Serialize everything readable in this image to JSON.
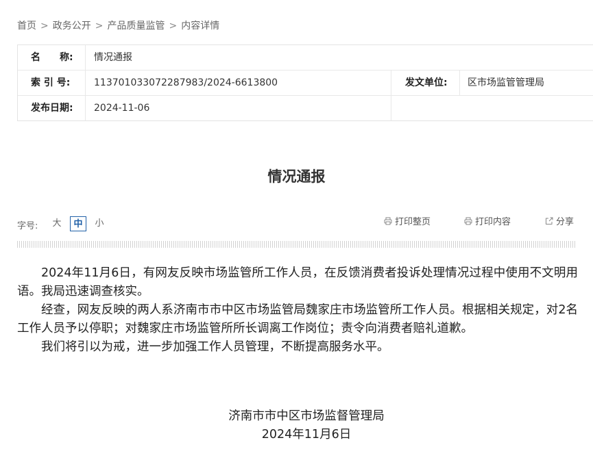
{
  "breadcrumb": {
    "items": [
      "首页",
      "政务公开",
      "产品质量监管",
      "内容详情"
    ],
    "separator": ">"
  },
  "info": {
    "name_label": "名　　称:",
    "name_value": "情况通报",
    "index_label": "索 引 号:",
    "index_value": "113701033072287983/2024-6613800",
    "issuer_label": "发文单位:",
    "issuer_value": "区市场监管管理局",
    "date_label": "发布日期:",
    "date_value": "2024-11-06"
  },
  "article": {
    "title": "情况通报",
    "paragraphs": [
      "2024年11月6日，有网友反映市场监管所工作人员，在反馈消费者投诉处理情况过程中使用不文明用语。我局迅速调查核实。",
      "经查，网友反映的两人系济南市市中区市场监管局魏家庄市场监管所工作人员。根据相关规定，对2名工作人员予以停职；对魏家庄市场监管所所长调离工作岗位；责令向消费者赔礼道歉。",
      "我们将引以为戒，进一步加强工作人员管理，不断提高服务水平。"
    ],
    "signature_org": "济南市市中区市场监督管理局",
    "signature_date": "2024年11月6日"
  },
  "toolbar": {
    "font_size_label": "字号:",
    "size_large": "大",
    "size_medium": "中",
    "size_small": "小",
    "selected_size": "中",
    "print_page": "打印整页",
    "print_content": "打印内容",
    "share": "分享",
    "icons": [
      "printer-icon",
      "printer-icon",
      "share-icon"
    ]
  },
  "colors": {
    "accent": "#2060a8",
    "text": "#222222",
    "muted": "#666666"
  }
}
